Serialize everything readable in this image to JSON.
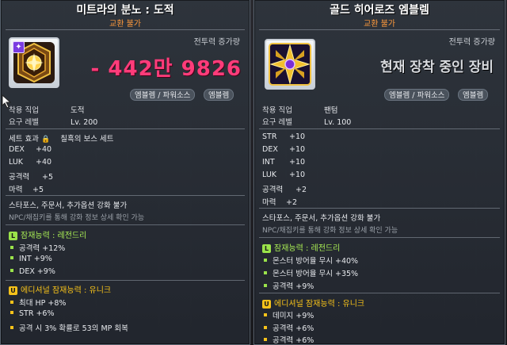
{
  "left": {
    "title": "미트라의 분노 : 도적",
    "trade": "교환 불가",
    "power_label": "전투력 증가량",
    "power_value": "- 442만 9826",
    "tags": [
      "엠블렘 / 파워소스",
      "엠블렘"
    ],
    "req_job_label": "착용 직업",
    "req_job": "도적",
    "req_level_label": "요구 레벨",
    "req_level": "Lv. 200",
    "set_label": "세트 효과",
    "set_name": "칠흑의 보스 세트",
    "stats": [
      {
        "k": "DEX",
        "v": "+40"
      },
      {
        "k": "LUK",
        "v": "+40"
      },
      {
        "k": "공격력",
        "v": "+5"
      },
      {
        "k": "마력",
        "v": "+5"
      }
    ],
    "note1": "스타포스, 주문서, 추가옵션 강화 불가",
    "note2": "NPC/채집키를 통해 강화 정보 상세 확인 가능",
    "potential_head": "잠재능력 : 레전드리",
    "potential_lines": [
      "공격력 +12%",
      "INT +9%",
      "DEX +9%"
    ],
    "additional_head": "에디셔널 잠재능력 : 유니크",
    "additional_lines": [
      "최대 HP +8%",
      "STR +6%",
      "공격 시 3% 확률로 53의 MP 회복"
    ]
  },
  "right": {
    "title": "골드 히어로즈 엠블렘",
    "trade": "교환 불가",
    "power_label": "전투력 증가량",
    "equipped": "현재 장착 중인 장비",
    "tags": [
      "엠블렘 / 파워소스",
      "엠블렘"
    ],
    "req_job_label": "착용 직업",
    "req_job": "팬텀",
    "req_level_label": "요구 레벨",
    "req_level": "Lv. 100",
    "stats": [
      {
        "k": "STR",
        "v": "+10"
      },
      {
        "k": "DEX",
        "v": "+10"
      },
      {
        "k": "INT",
        "v": "+10"
      },
      {
        "k": "LUK",
        "v": "+10"
      },
      {
        "k": "공격력",
        "v": "+2"
      },
      {
        "k": "마력",
        "v": "+2"
      }
    ],
    "note1": "스타포스, 주문서, 추가옵션 강화 불가",
    "note2": "NPC/채집키를 통해 강화 정보 상세 확인 가능",
    "potential_head": "잠재능력 : 레전드리",
    "potential_lines": [
      "몬스터 방어율 무시 +40%",
      "몬스터 방어율 무시 +35%",
      "공격력 +9%"
    ],
    "additional_head": "에디셔널 잠재능력 : 유니크",
    "additional_lines": [
      "데미지 +9%",
      "공격력 +6%",
      "공격력 +6%"
    ]
  },
  "colors": {
    "legendary": "#9ae34a",
    "unique": "#f6c21a",
    "power": "#ff3c7a",
    "trade": "#ff9a3c"
  },
  "icons": {
    "left_item": "mitra-emblem-icon",
    "right_item": "gold-heroes-emblem-icon",
    "rarity_badge": "legendary-badge-icon",
    "cursor": "hand-cursor-icon"
  }
}
